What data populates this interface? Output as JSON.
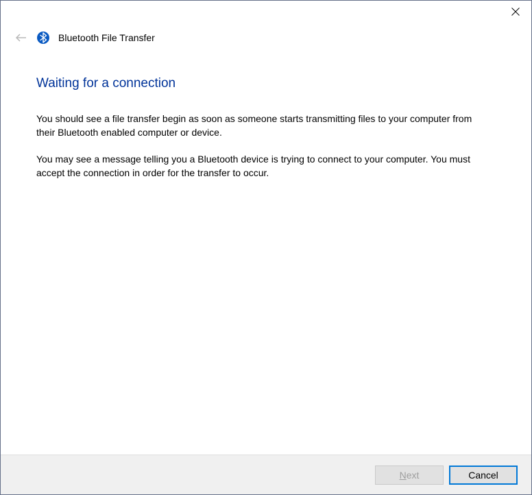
{
  "titlebar": {
    "close_tooltip": "Close"
  },
  "header": {
    "title": "Bluetooth File Transfer"
  },
  "content": {
    "heading": "Waiting for a connection",
    "paragraph1": "You should see a file transfer begin as soon as someone starts transmitting files to your computer from their Bluetooth enabled computer or device.",
    "paragraph2": "You may see a message telling you a Bluetooth device is trying to connect to your computer. You must accept the connection in order for the transfer to occur."
  },
  "footer": {
    "next_prefix": "N",
    "next_rest": "ext",
    "cancel": "Cancel"
  }
}
